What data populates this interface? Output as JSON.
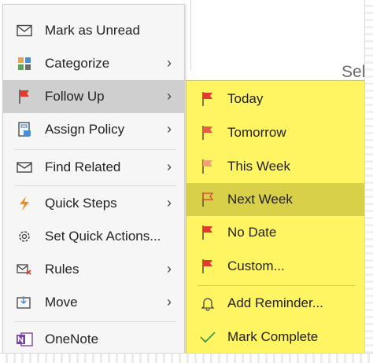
{
  "background": {
    "partial_text": "Sel"
  },
  "menu": {
    "items": [
      {
        "label": "Mark as Unread",
        "icon": "envelope-icon",
        "has_arrow": false
      },
      {
        "label": "Categorize",
        "icon": "categorize-icon",
        "has_arrow": true
      },
      {
        "label": "Follow Up",
        "icon": "flag-icon",
        "has_arrow": true,
        "selected": true
      },
      {
        "label": "Assign Policy",
        "icon": "policy-icon",
        "has_arrow": true
      },
      {
        "label": "Find Related",
        "icon": "find-related-icon",
        "has_arrow": true
      },
      {
        "label": "Quick Steps",
        "icon": "lightning-icon",
        "has_arrow": true
      },
      {
        "label": "Set Quick Actions...",
        "icon": "gear-icon",
        "has_arrow": false
      },
      {
        "label": "Rules",
        "icon": "rules-icon",
        "has_arrow": true
      },
      {
        "label": "Move",
        "icon": "move-icon",
        "has_arrow": true
      },
      {
        "label": "OneNote",
        "icon": "onenote-icon",
        "has_arrow": false
      }
    ],
    "arrow_glyph": "›"
  },
  "submenu": {
    "items": [
      {
        "label": "Today",
        "icon": "flag-red-icon"
      },
      {
        "label": "Tomorrow",
        "icon": "flag-red-icon"
      },
      {
        "label": "This Week",
        "icon": "flag-light-icon"
      },
      {
        "label": "Next Week",
        "icon": "flag-outline-icon",
        "highlighted": true
      },
      {
        "label": "No Date",
        "icon": "flag-red-icon"
      },
      {
        "label": "Custom...",
        "icon": "flag-red-icon"
      },
      {
        "label": "Add Reminder...",
        "icon": "bell-icon"
      },
      {
        "label": "Mark Complete",
        "icon": "checkmark-icon"
      }
    ]
  },
  "colors": {
    "highlight_yellow": "#fff462",
    "submenu_selected": "#d9d04a",
    "menu_selected": "#cfcfcf",
    "flag_red": "#e23b2e"
  }
}
